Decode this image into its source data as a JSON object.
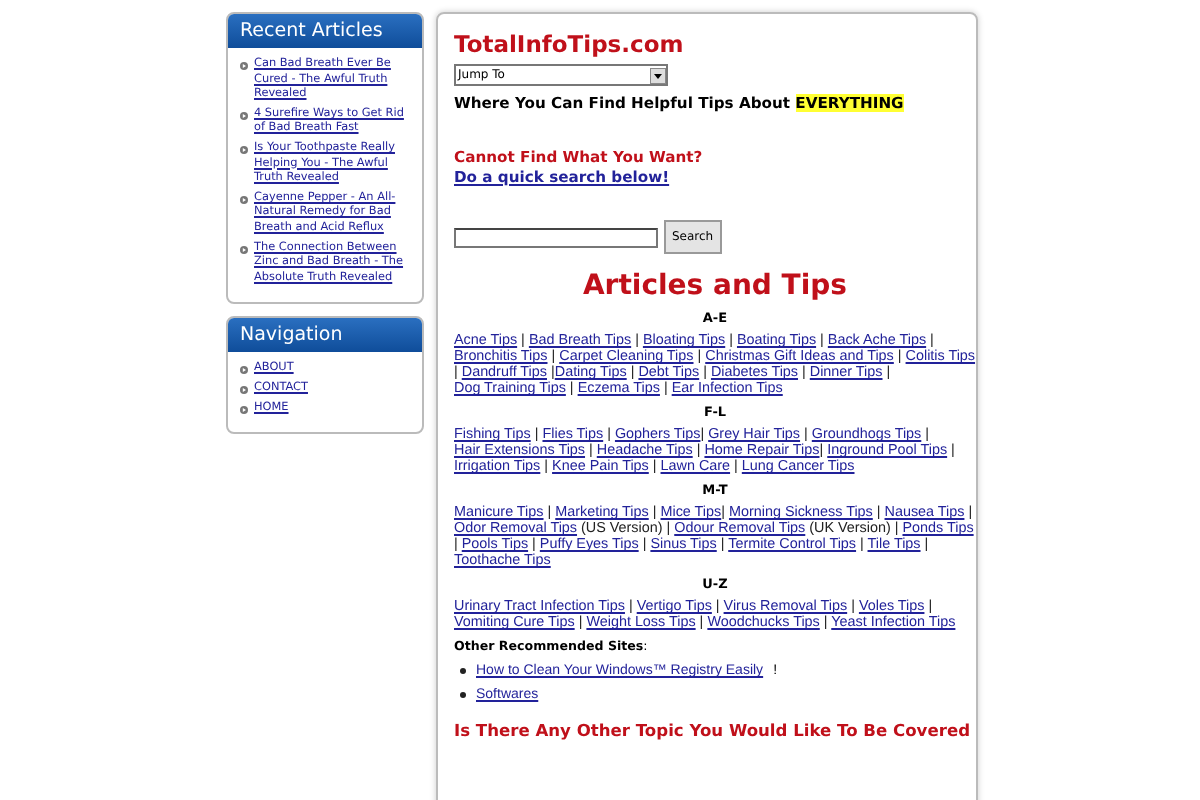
{
  "sidebar": [
    {
      "title": "Recent Articles",
      "items": [
        "Can Bad Breath Ever Be Cured - The Awful Truth Revealed",
        "4 Surefire Ways to Get Rid of Bad Breath Fast",
        "Is Your Toothpaste Really Helping You - The Awful Truth Revealed",
        "Cayenne Pepper - An All-Natural Remedy for Bad Breath and Acid Reflux",
        "The Connection Between Zinc and Bad Breath - The Absolute Truth Revealed"
      ]
    },
    {
      "title": "Navigation",
      "items": [
        "ABOUT",
        "CONTACT",
        "HOME"
      ]
    }
  ],
  "main": {
    "site_title": "TotalInfoTips.com",
    "jump_select": {
      "value": "Jump To"
    },
    "tagline": "Where You Can Find Helpful Tips About ",
    "tagline_highlight": "EVERYTHING",
    "prompt": "Cannot Find What You Want? ",
    "prompt_link": "Do a quick search below!",
    "search_button": "Search",
    "section_title": "Articles and Tips",
    "sections": [
      {
        "heading": "A-E",
        "links": [
          {
            "text": "Acne Tips",
            "after": " | "
          },
          {
            "text": "Bad Breath Tips",
            "after": " | "
          },
          {
            "text": "Bloating Tips",
            "after": " | "
          },
          {
            "text": "Boating Tips",
            "after": " | "
          },
          {
            "text": "Back Ache Tips",
            "after": " | "
          },
          {
            "text": "Bronchitis Tips",
            "after": " | "
          },
          {
            "text": "Carpet Cleaning Tips",
            "after": " | "
          },
          {
            "text": "Christmas Gift Ideas and Tips",
            "after": " | "
          },
          {
            "text": "Colitis Tips",
            "after": " | "
          },
          {
            "text": "Dandruff Tips",
            "after": " |"
          },
          {
            "text": "Dating Tips",
            "after": " | "
          },
          {
            "text": "Debt Tips",
            "after": " | "
          },
          {
            "text": "Diabetes Tips",
            "after": " | "
          },
          {
            "text": "Dinner Tips",
            "after": " | "
          },
          {
            "text": "Dog Training Tips",
            "after": " | "
          },
          {
            "text": "Eczema Tips",
            "after": " | "
          },
          {
            "text": "Ear Infection Tips"
          }
        ]
      },
      {
        "heading": "F-L",
        "links": [
          {
            "text": "Fishing Tips",
            "after": " | "
          },
          {
            "text": "Flies Tips",
            "after": " | "
          },
          {
            "text": "Gophers Tips",
            "after": "| "
          },
          {
            "text": "Grey Hair Tips",
            "after": " | "
          },
          {
            "text": "Groundhogs Tips",
            "after": " | "
          },
          {
            "text": "Hair Extensions Tips",
            "after": " | "
          },
          {
            "text": "Headache Tips",
            "after": " | "
          },
          {
            "text": "Home Repair Tips",
            "after": "| "
          },
          {
            "text": "Inground Pool Tips",
            "after": " | "
          },
          {
            "text": "Irrigation Tips",
            "after": " | "
          },
          {
            "text": "Knee Pain Tips",
            "after": " | "
          },
          {
            "text": "Lawn Care",
            "after": " | "
          },
          {
            "text": "Lung Cancer Tips"
          }
        ]
      },
      {
        "heading": "M-T",
        "links": [
          {
            "text": "Manicure Tips",
            "after": " | "
          },
          {
            "text": "Marketing Tips",
            "after": " | "
          },
          {
            "text": "Mice Tips",
            "after": "| "
          },
          {
            "text": "Morning Sickness Tips",
            "after": " | "
          },
          {
            "text": "Nausea Tips",
            "after": " | "
          },
          {
            "text": "Odor Removal Tips",
            "after": " (US Version) | "
          },
          {
            "text": "Odour Removal Tips",
            "after": " (UK Version) | "
          },
          {
            "text": "Ponds Tips",
            "after": " | "
          },
          {
            "text": "Pools Tips",
            "after": " | "
          },
          {
            "text": "Puffy Eyes Tips",
            "after": " | "
          },
          {
            "text": "Sinus Tips",
            "after": " | "
          },
          {
            "text": "Termite Control Tips",
            "after": " | "
          },
          {
            "text": "Tile Tips",
            "after": " | "
          },
          {
            "text": "Toothache Tips"
          }
        ]
      },
      {
        "heading": "U-Z",
        "links": [
          {
            "text": "Urinary Tract Infection Tips",
            "after": " | "
          },
          {
            "text": "Vertigo Tips",
            "after": " | "
          },
          {
            "text": "Virus Removal Tips",
            "after": " | "
          },
          {
            "text": "Voles Tips",
            "after": " | "
          },
          {
            "text": "Vomiting Cure Tips",
            "after": " | "
          },
          {
            "text": "Weight Loss Tips",
            "after": " | "
          },
          {
            "text": "Woodchucks Tips",
            "after": " | "
          },
          {
            "text": "Yeast Infection Tips"
          }
        ]
      }
    ],
    "other_sites": {
      "heading": "Other Recommended Sites",
      "after": ":",
      "items": [
        {
          "text": "How to Clean Your Windows™ Registry Easily",
          "after": "!"
        },
        {
          "text": "Softwares"
        }
      ]
    },
    "footer_question": "Is There Any Other Topic You Would Like To Be Covered"
  }
}
